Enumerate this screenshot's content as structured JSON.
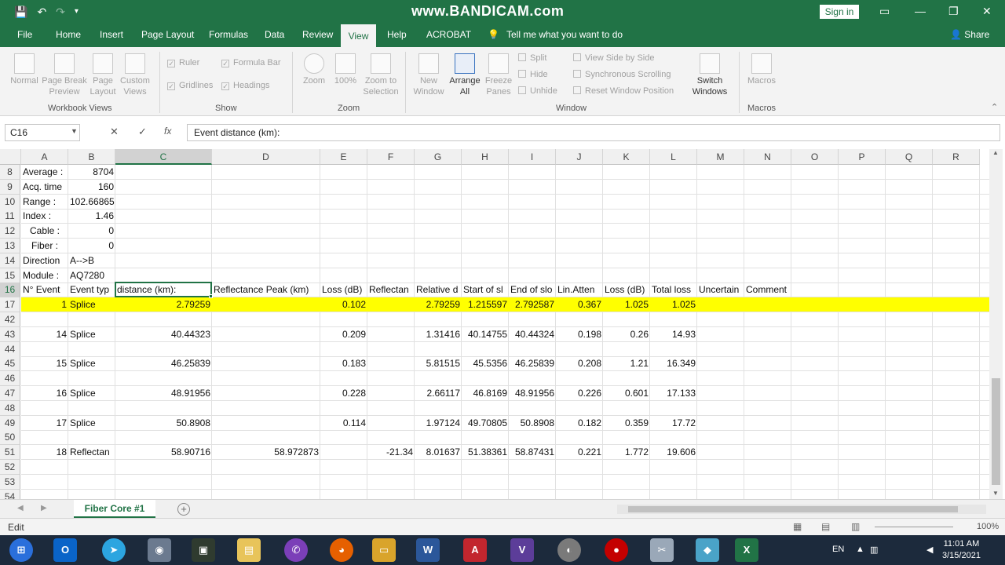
{
  "titlebar": {
    "watermark": "www.BANDICAM.com",
    "signin": "Sign in"
  },
  "tabs": [
    "File",
    "Home",
    "Insert",
    "Page Layout",
    "Formulas",
    "Data",
    "Review",
    "View",
    "Help",
    "ACROBAT"
  ],
  "tell_me": "Tell me what you want to do",
  "share": "Share",
  "ribbon": {
    "groups": {
      "workbook_views": "Workbook Views",
      "show": "Show",
      "zoom": "Zoom",
      "window": "Window",
      "macros": "Macros"
    },
    "buttons": {
      "normal": "Normal",
      "page_break": "Page Break Preview",
      "page_layout": "Page Layout",
      "custom_views": "Custom Views",
      "ruler": "Ruler",
      "formula_bar": "Formula Bar",
      "gridlines": "Gridlines",
      "headings": "Headings",
      "zoom": "Zoom",
      "zoom100": "100%",
      "zoom_selection": "Zoom to Selection",
      "new_window": "New Window",
      "arrange_all": "Arrange All",
      "freeze_panes": "Freeze Panes",
      "split": "Split",
      "hide": "Hide",
      "unhide": "Unhide",
      "view_side": "View Side by Side",
      "sync_scroll": "Synchronous Scrolling",
      "reset_window": "Reset Window Position",
      "switch_windows": "Switch Windows",
      "macros": "Macros"
    }
  },
  "formula_bar": {
    "name_box": "C16",
    "value": "Event distance (km):"
  },
  "columns": [
    "A",
    "B",
    "C",
    "D",
    "E",
    "F",
    "G",
    "H",
    "I",
    "J",
    "K",
    "L",
    "M",
    "N",
    "O",
    "P",
    "Q",
    "R"
  ],
  "rows": [
    {
      "num": "8",
      "cells": {
        "A": "Average :",
        "B": "8704"
      }
    },
    {
      "num": "9",
      "cells": {
        "A": "Acq. time",
        "B": "160"
      }
    },
    {
      "num": "10",
      "cells": {
        "A": "Range :",
        "B": "102.66865 km"
      }
    },
    {
      "num": "11",
      "cells": {
        "A": "Index :",
        "B": "1.46"
      }
    },
    {
      "num": "12",
      "cells": {
        "A": "Cable :",
        "B": "0"
      }
    },
    {
      "num": "13",
      "cells": {
        "A": "Fiber :",
        "B": "0"
      }
    },
    {
      "num": "14",
      "cells": {
        "A": "Direction",
        "B": "A-->B"
      }
    },
    {
      "num": "15",
      "cells": {
        "A": "Module :",
        "B": "AQ7280"
      }
    },
    {
      "num": "16",
      "cells": {
        "A": "N° Event",
        "B": "Event typ",
        "C": "distance (km):",
        "D": "Reflectance Peak (km)",
        "E": "Loss (dB)",
        "F": "Reflectan",
        "G": "Relative d",
        "H": "Start of sl",
        "I": "End of slo",
        "J": "Lin.Atten",
        "K": "Loss (dB)",
        "L": "Total loss",
        "M": "Uncertain",
        "N": "Comment"
      }
    },
    {
      "num": "17",
      "cells": {
        "A": "1",
        "B": "Splice",
        "C": "2.79259",
        "E": "0.102",
        "G": "2.79259",
        "H": "1.215597",
        "I": "2.792587",
        "J": "0.367",
        "K": "1.025",
        "L": "1.025"
      }
    },
    {
      "num": "42",
      "cells": {}
    },
    {
      "num": "43",
      "cells": {
        "A": "14",
        "B": "Splice",
        "C": "40.44323",
        "E": "0.209",
        "G": "1.31416",
        "H": "40.14755",
        "I": "40.44324",
        "J": "0.198",
        "K": "0.26",
        "L": "14.93"
      }
    },
    {
      "num": "44",
      "cells": {}
    },
    {
      "num": "45",
      "cells": {
        "A": "15",
        "B": "Splice",
        "C": "46.25839",
        "E": "0.183",
        "G": "5.81515",
        "H": "45.5356",
        "I": "46.25839",
        "J": "0.208",
        "K": "1.21",
        "L": "16.349"
      }
    },
    {
      "num": "46",
      "cells": {}
    },
    {
      "num": "47",
      "cells": {
        "A": "16",
        "B": "Splice",
        "C": "48.91956",
        "E": "0.228",
        "G": "2.66117",
        "H": "46.8169",
        "I": "48.91956",
        "J": "0.226",
        "K": "0.601",
        "L": "17.133"
      }
    },
    {
      "num": "48",
      "cells": {}
    },
    {
      "num": "49",
      "cells": {
        "A": "17",
        "B": "Splice",
        "C": "50.8908",
        "E": "0.114",
        "G": "1.97124",
        "H": "49.70805",
        "I": "50.8908",
        "J": "0.182",
        "K": "0.359",
        "L": "17.72"
      }
    },
    {
      "num": "50",
      "cells": {}
    },
    {
      "num": "51",
      "cells": {
        "A": "18",
        "B": "Reflectan",
        "C": "58.90716",
        "D": "58.972873",
        "F": "-21.34",
        "G": "8.01637",
        "H": "51.38361",
        "I": "58.87431",
        "J": "0.221",
        "K": "1.772",
        "L": "19.606"
      }
    },
    {
      "num": "52",
      "cells": {}
    },
    {
      "num": "53",
      "cells": {}
    },
    {
      "num": "54",
      "cells": {}
    }
  ],
  "sheet_tab": "Fiber Core #1",
  "status": "Edit",
  "zoom_level": "100%",
  "taskbar": {
    "lang": "EN",
    "time": "11:01 AM",
    "date": "3/15/2021"
  },
  "colors": {
    "excel_green": "#217346",
    "highlight_yellow": "#ffff00"
  }
}
